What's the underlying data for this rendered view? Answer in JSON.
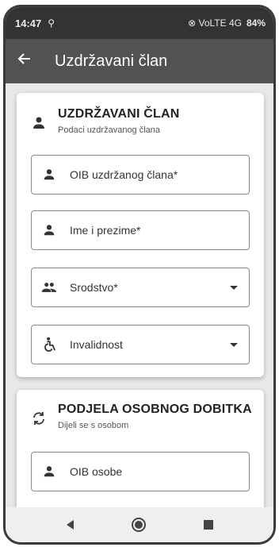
{
  "statusbar": {
    "time": "14:47",
    "left_icons": "⚲",
    "right_icons": "⊗ VoLTE 4G",
    "battery": "84%"
  },
  "appbar": {
    "back_icon": "arrow-left-icon",
    "title": "Uzdržavani član"
  },
  "card1": {
    "title": "UZDRŽAVANI ČLAN",
    "subtitle": "Podaci uzdržavanog člana",
    "fields": [
      {
        "label": "OIB uzdržanog člana*",
        "icon": "person-icon"
      },
      {
        "label": "Ime i prezime*",
        "icon": "person-icon"
      },
      {
        "label": "Srodstvo*",
        "icon": "people-icon",
        "dropdown": true
      },
      {
        "label": "Invalidnost",
        "icon": "accessibility-icon",
        "dropdown": true
      }
    ]
  },
  "card2": {
    "title": "PODJELA OSOBNOG DOBITKA",
    "subtitle": "Dijeli se s osobom",
    "fields": [
      {
        "label": "OIB osobe",
        "icon": "person-icon"
      }
    ]
  },
  "colors": {
    "statusbar": "#333333",
    "appbar": "#525252",
    "background": "#e8e8e8"
  }
}
